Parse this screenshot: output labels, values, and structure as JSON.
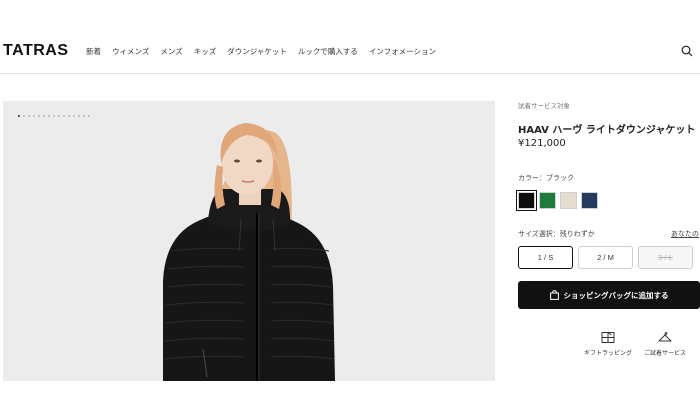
{
  "header": {
    "logo": "TATRAS",
    "nav": [
      "新着",
      "ウィメンズ",
      "メンズ",
      "キッズ",
      "ダウンジャケット",
      "ルックで購入する",
      "インフォメーション"
    ],
    "search_icon": "search-icon"
  },
  "gallery": {
    "image_count": 15,
    "active_index": 0,
    "image_subject": "model wearing black hooded quilted down jacket"
  },
  "product": {
    "trial_tag": "試着サービス対象",
    "title": "HAAV ハーヴ ライトダウンジャケット",
    "price": "¥121,000"
  },
  "color": {
    "label": "カラー：ブラック",
    "swatches": [
      {
        "name": "black",
        "hex": "#0d0d0d",
        "selected": true
      },
      {
        "name": "green",
        "hex": "#1f7a3d",
        "selected": false
      },
      {
        "name": "beige",
        "hex": "#e6ddd2",
        "selected": false
      },
      {
        "name": "navy",
        "hex": "#263a5e",
        "selected": false
      }
    ]
  },
  "size": {
    "label": "サイズ選択：残りわずか",
    "guide": "あなたの",
    "options": [
      {
        "label": "1 / S",
        "state": "selected"
      },
      {
        "label": "2 / M",
        "state": "available"
      },
      {
        "label": "3 / L",
        "state": "sold-out"
      }
    ]
  },
  "cart": {
    "add_label": "ショッピングバッグに追加する",
    "icon": "shopping-bag-icon"
  },
  "services": {
    "gift_label": "ギフトラッピング",
    "gift_icon": "gift-box-icon",
    "trial_label": "ご試着サービス",
    "trial_icon": "hanger-icon"
  },
  "colors": {
    "primary": "#111111",
    "hero_background": "#ececec",
    "border": "#e2e2e2"
  }
}
